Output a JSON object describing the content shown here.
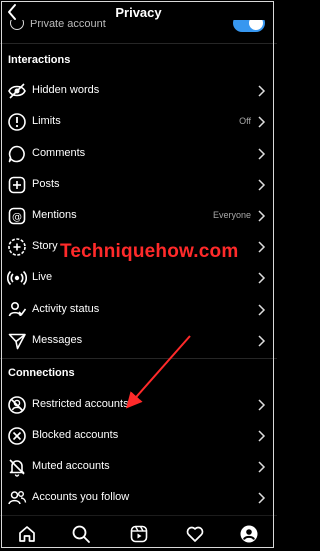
{
  "header": {
    "title": "Privacy"
  },
  "partial_row": {
    "label": "Private account",
    "toggle_on": true
  },
  "sections": {
    "interactions": {
      "title": "Interactions",
      "items": [
        {
          "label": "Hidden words",
          "value": ""
        },
        {
          "label": "Limits",
          "value": "Off"
        },
        {
          "label": "Comments",
          "value": ""
        },
        {
          "label": "Posts",
          "value": ""
        },
        {
          "label": "Mentions",
          "value": "Everyone"
        },
        {
          "label": "Story",
          "value": ""
        },
        {
          "label": "Live",
          "value": ""
        },
        {
          "label": "Activity status",
          "value": ""
        },
        {
          "label": "Messages",
          "value": ""
        }
      ]
    },
    "connections": {
      "title": "Connections",
      "items": [
        {
          "label": "Restricted accounts"
        },
        {
          "label": "Blocked accounts"
        },
        {
          "label": "Muted accounts"
        },
        {
          "label": "Accounts you follow"
        }
      ]
    }
  },
  "watermark": "Techniquehow.com",
  "colors": {
    "accent": "#3797f0",
    "annotation": "#ff2a2a",
    "background": "#000000"
  },
  "bottom_nav": [
    "home-icon",
    "search-icon",
    "reels-icon",
    "heart-icon",
    "profile-icon"
  ]
}
